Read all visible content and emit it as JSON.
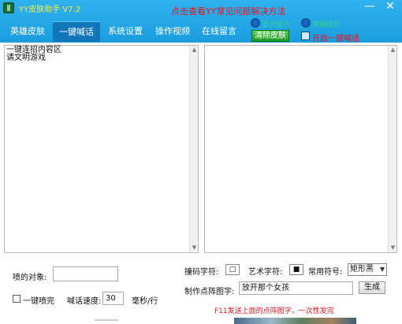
{
  "window": {
    "title": "YY皮肤助手 V7.2",
    "help_link": "点击查看YY常见问题解决方法",
    "minimize": "—",
    "close": "✕"
  },
  "tabs": [
    {
      "label": "英雄皮肤",
      "active": false
    },
    {
      "label": "一键喊话",
      "active": true
    },
    {
      "label": "系统设置",
      "active": false
    },
    {
      "label": "操作视频",
      "active": false
    },
    {
      "label": "在线留言",
      "active": false
    }
  ],
  "header_controls": {
    "radio_1_label": "显示提示",
    "radio_2_label": "关闭提示",
    "clear_skin_button": "清除皮肤",
    "auto_shout_checkbox": "开启一键喊话"
  },
  "left_pane": {
    "lines": [
      "一键连招内容区",
      "请文明游戏"
    ]
  },
  "right_pane": {
    "lines": []
  },
  "controls": {
    "target_label": "喷的对象:",
    "target_value": "",
    "one_key_spray_label": "一键喷完",
    "speed_label": "喊话速度:",
    "speed_value": "30",
    "speed_unit": "毫秒/行",
    "mosaic_char_label": "撞码字符:",
    "mosaic_char_value": "□",
    "art_char_label": "艺术字符:",
    "art_char_value": "■",
    "common_symbol_label": "常用符号:",
    "common_symbol_value": "矩形黑",
    "make_pattern_label": "制作点阵图字:",
    "pattern_text_value": "放开那个女孩",
    "generate_button": "生成",
    "hint_text": "F11发送上面的点阵图字，一次性发完"
  },
  "colors": {
    "titlebar": "#1a9ddf",
    "active_tab": "#1076b8",
    "accent_red": "#e8141c",
    "title_yellow": "#ffea3a",
    "clear_button_green": "#1e9a22"
  }
}
